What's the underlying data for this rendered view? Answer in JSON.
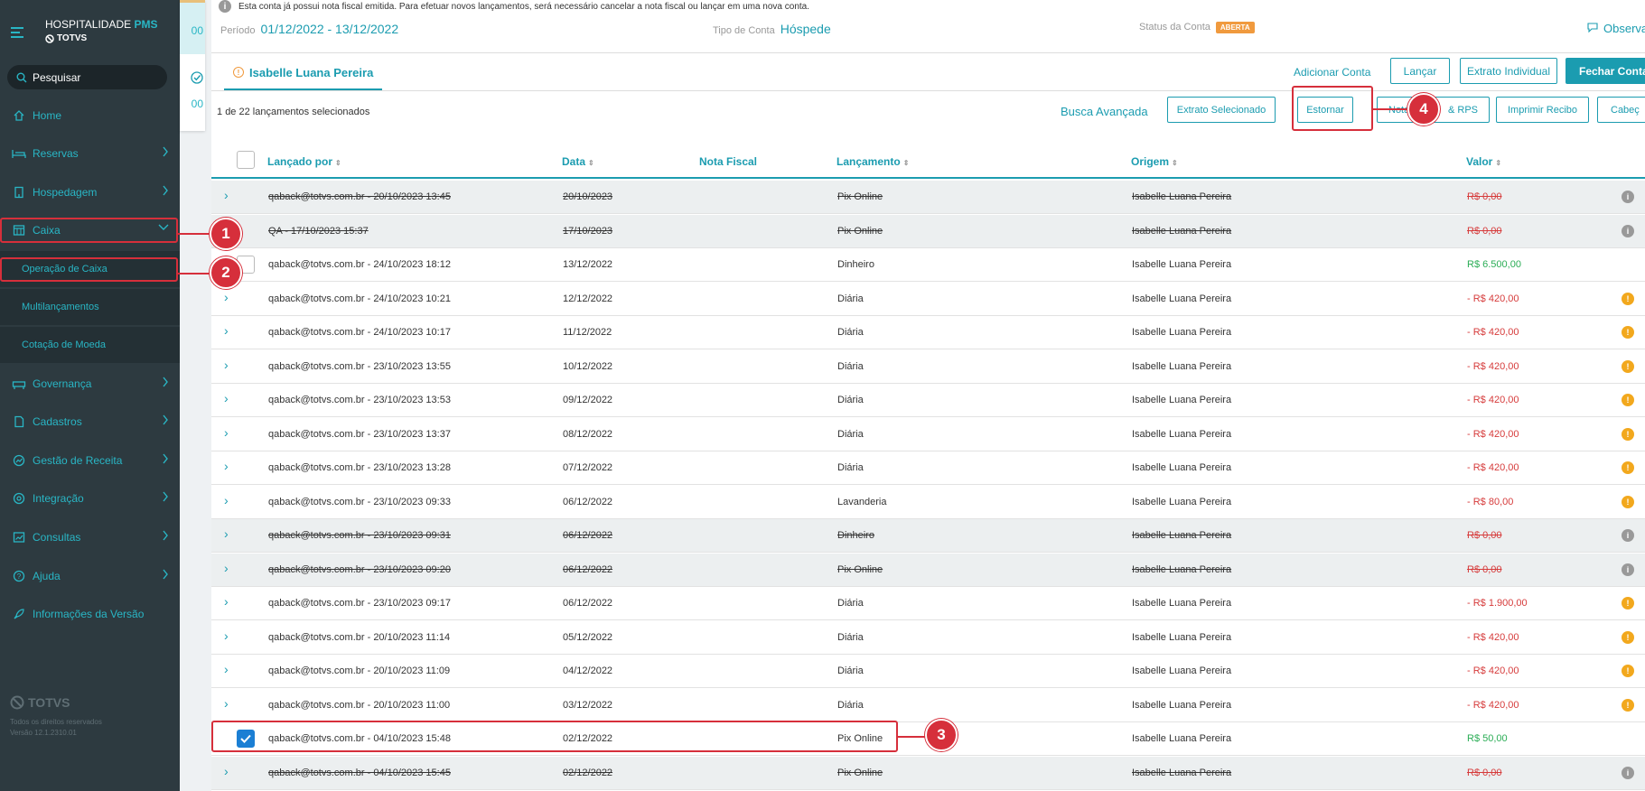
{
  "sidebar": {
    "brand": {
      "name": "HOSPITALIDADE",
      "suffix": "PMS",
      "company": "TOTVS"
    },
    "search_placeholder": "Pesquisar",
    "items": [
      {
        "label": "Home",
        "icon": "home-icon"
      },
      {
        "label": "Reservas",
        "icon": "bed-icon"
      },
      {
        "label": "Hospedagem",
        "icon": "building-icon"
      },
      {
        "label": "Caixa",
        "icon": "cash-register-icon"
      },
      {
        "label": "Governança",
        "icon": "housekeeping-icon"
      },
      {
        "label": "Cadastros",
        "icon": "document-icon"
      },
      {
        "label": "Gestão de Receita",
        "icon": "revenue-icon"
      },
      {
        "label": "Integração",
        "icon": "integration-icon"
      },
      {
        "label": "Consultas",
        "icon": "chart-icon"
      },
      {
        "label": "Ajuda",
        "icon": "help-icon"
      },
      {
        "label": "Informações da Versão",
        "icon": "rocket-icon"
      }
    ],
    "subitems": [
      {
        "label": "Operação de Caixa"
      },
      {
        "label": "Multilançamentos"
      },
      {
        "label": "Cotação de Moeda"
      }
    ],
    "footer": {
      "logo": "TOTVS",
      "rights": "Todos os direitos reservados",
      "version": "Versão 12.1.2310.01"
    }
  },
  "left_panel": {
    "top_value": "00",
    "bottom_value": "00"
  },
  "notice": "Esta conta já possui nota fiscal emitida. Para efetuar novos lançamentos, será necessário cancelar a nota fiscal ou lançar em uma nova conta.",
  "header": {
    "period_label": "Período",
    "period_value": "01/12/2022 - 13/12/2022",
    "account_type_label": "Tipo de Conta",
    "account_type_value": "Hóspede",
    "status_label": "Status da Conta",
    "status_value": "ABERTA",
    "observations": "Observa"
  },
  "tab": {
    "label": "Isabelle Luana Pereira"
  },
  "actions": {
    "add_account": "Adicionar Conta",
    "launch": "Lançar",
    "individual_statement": "Extrato Individual",
    "close_account": "Fechar Conta"
  },
  "toolbar": {
    "selected_count": "1",
    "selected_text": "de 22 lançamentos selecionados",
    "advanced_search": "Busca Avançada",
    "selected_statement": "Extrato Selecionado",
    "reverse": "Estornar",
    "invoice_left": "Nota",
    "invoice_right": "& RPS",
    "print_receipt": "Imprimir Recibo",
    "header_btn": "Cabeç"
  },
  "table": {
    "columns": [
      "Lançado por",
      "Data",
      "Nota Fiscal",
      "Lançamento",
      "Origem",
      "Valor"
    ],
    "rows": [
      {
        "by": "qaback@totvs.com.br - 20/10/2023 13:45",
        "date": "20/10/2023",
        "invoice": "",
        "entry": "Pix Online",
        "origin": "Isabelle Luana Pereira",
        "value": "R$ 0,00",
        "status": "cancelled"
      },
      {
        "by": "QA - 17/10/2023 15:37",
        "date": "17/10/2023",
        "invoice": "",
        "entry": "Pix Online",
        "origin": "Isabelle Luana Pereira",
        "value": "R$ 0,00",
        "status": "cancelled"
      },
      {
        "by": "qaback@totvs.com.br - 24/10/2023 18:12",
        "date": "13/12/2022",
        "invoice": "",
        "entry": "Dinheiro",
        "origin": "Isabelle Luana Pereira",
        "value": "R$ 6.500,00",
        "status": "payment"
      },
      {
        "by": "qaback@totvs.com.br - 24/10/2023 10:21",
        "date": "12/12/2022",
        "invoice": "",
        "entry": "Diária",
        "origin": "Isabelle Luana Pereira",
        "value": "- R$ 420,00",
        "status": "charge"
      },
      {
        "by": "qaback@totvs.com.br - 24/10/2023 10:17",
        "date": "11/12/2022",
        "invoice": "",
        "entry": "Diária",
        "origin": "Isabelle Luana Pereira",
        "value": "- R$ 420,00",
        "status": "charge"
      },
      {
        "by": "qaback@totvs.com.br - 23/10/2023 13:55",
        "date": "10/12/2022",
        "invoice": "",
        "entry": "Diária",
        "origin": "Isabelle Luana Pereira",
        "value": "- R$ 420,00",
        "status": "charge"
      },
      {
        "by": "qaback@totvs.com.br - 23/10/2023 13:53",
        "date": "09/12/2022",
        "invoice": "",
        "entry": "Diária",
        "origin": "Isabelle Luana Pereira",
        "value": "- R$ 420,00",
        "status": "charge"
      },
      {
        "by": "qaback@totvs.com.br - 23/10/2023 13:37",
        "date": "08/12/2022",
        "invoice": "",
        "entry": "Diária",
        "origin": "Isabelle Luana Pereira",
        "value": "- R$ 420,00",
        "status": "charge"
      },
      {
        "by": "qaback@totvs.com.br - 23/10/2023 13:28",
        "date": "07/12/2022",
        "invoice": "",
        "entry": "Diária",
        "origin": "Isabelle Luana Pereira",
        "value": "- R$ 420,00",
        "status": "charge"
      },
      {
        "by": "qaback@totvs.com.br - 23/10/2023 09:33",
        "date": "06/12/2022",
        "invoice": "",
        "entry": "Lavanderia",
        "origin": "Isabelle Luana Pereira",
        "value": "- R$ 80,00",
        "status": "charge"
      },
      {
        "by": "qaback@totvs.com.br - 23/10/2023 09:31",
        "date": "06/12/2022",
        "invoice": "",
        "entry": "Dinheiro",
        "origin": "Isabelle Luana Pereira",
        "value": "R$ 0,00",
        "status": "cancelled"
      },
      {
        "by": "qaback@totvs.com.br - 23/10/2023 09:20",
        "date": "06/12/2022",
        "invoice": "",
        "entry": "Pix Online",
        "origin": "Isabelle Luana Pereira",
        "value": "R$ 0,00",
        "status": "cancelled"
      },
      {
        "by": "qaback@totvs.com.br - 23/10/2023 09:17",
        "date": "06/12/2022",
        "invoice": "",
        "entry": "Diária",
        "origin": "Isabelle Luana Pereira",
        "value": "- R$ 1.900,00",
        "status": "charge"
      },
      {
        "by": "qaback@totvs.com.br - 20/10/2023 11:14",
        "date": "05/12/2022",
        "invoice": "",
        "entry": "Diária",
        "origin": "Isabelle Luana Pereira",
        "value": "- R$ 420,00",
        "status": "charge"
      },
      {
        "by": "qaback@totvs.com.br - 20/10/2023 11:09",
        "date": "04/12/2022",
        "invoice": "",
        "entry": "Diária",
        "origin": "Isabelle Luana Pereira",
        "value": "- R$ 420,00",
        "status": "charge"
      },
      {
        "by": "qaback@totvs.com.br - 20/10/2023 11:00",
        "date": "03/12/2022",
        "invoice": "",
        "entry": "Diária",
        "origin": "Isabelle Luana Pereira",
        "value": "- R$ 420,00",
        "status": "charge"
      },
      {
        "by": "qaback@totvs.com.br - 04/10/2023 15:48",
        "date": "02/12/2022",
        "invoice": "",
        "entry": "Pix Online",
        "origin": "Isabelle Luana Pereira",
        "value": "R$ 50,00",
        "status": "selected"
      },
      {
        "by": "qaback@totvs.com.br - 04/10/2023 15:45",
        "date": "02/12/2022",
        "invoice": "",
        "entry": "Pix Online",
        "origin": "Isabelle Luana Pereira",
        "value": "R$ 0,00",
        "status": "cancelled"
      }
    ]
  },
  "annotations": {
    "m1": "1",
    "m2": "2",
    "m3": "3",
    "m4": "4"
  },
  "colors": {
    "accent": "#1b9cb0",
    "sidebar": "#2d3a40",
    "highlight": "#d62f3b",
    "warning": "#f2a81d",
    "positive": "#2bad56",
    "negative": "#d63b3b"
  }
}
